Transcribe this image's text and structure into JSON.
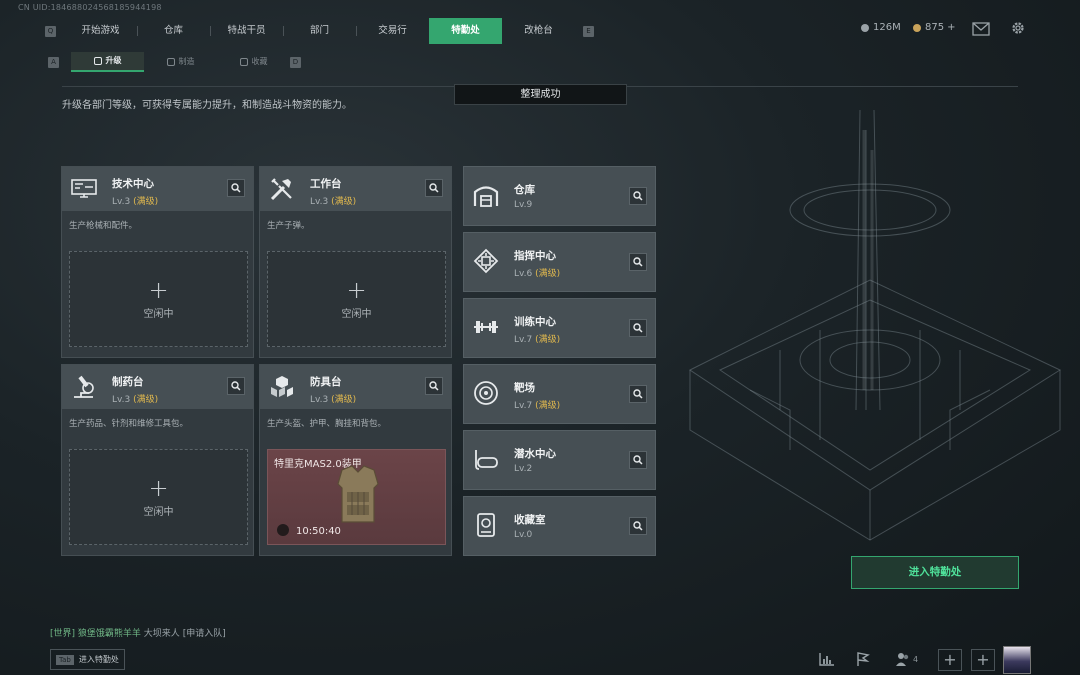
{
  "uid": "CN UID:184688024568185944198",
  "nav": {
    "left_key": "Q",
    "right_key": "E",
    "tabs": [
      "开始游戏",
      "仓库",
      "特战干员",
      "部门",
      "交易行",
      "特勤处",
      "改枪台"
    ],
    "active_tab": "特勤处"
  },
  "currency": {
    "coins": "126M",
    "points": "875",
    "points_plus": "+"
  },
  "subnav": {
    "left_key": "A",
    "right_key": "D",
    "tabs": [
      "升级",
      "制造",
      "收藏"
    ],
    "active": "升级"
  },
  "description": "升级各部门等级，可获得专属能力提升，和制造战斗物资的能力。",
  "toast": "整理成功",
  "idle_label": "空闲中",
  "max_label": "(满级)",
  "craft_departments": [
    {
      "name": "技术中心",
      "level": "Lv.3",
      "desc": "生产枪械和配件。",
      "icon": "tech-center-icon"
    },
    {
      "name": "工作台",
      "level": "Lv.3",
      "desc": "生产子弹。",
      "icon": "workbench-icon"
    },
    {
      "name": "制药台",
      "level": "Lv.3",
      "desc": "生产药品、针剂和维修工具包。",
      "icon": "pharmacy-icon"
    },
    {
      "name": "防具台",
      "level": "Lv.3",
      "desc": "生产头盔、护甲、胸挂和背包。",
      "icon": "armor-bench-icon"
    }
  ],
  "crafting_item": {
    "name": "特里克MAS2.0装甲",
    "time": "10:50:40"
  },
  "other_departments": [
    {
      "name": "仓库",
      "level": "Lv.9",
      "max": false,
      "icon": "warehouse-icon"
    },
    {
      "name": "指挥中心",
      "level": "Lv.6",
      "max": true,
      "icon": "command-center-icon"
    },
    {
      "name": "训练中心",
      "level": "Lv.7",
      "max": true,
      "icon": "training-center-icon"
    },
    {
      "name": "靶场",
      "level": "Lv.7",
      "max": true,
      "icon": "shooting-range-icon"
    },
    {
      "name": "潜水中心",
      "level": "Lv.2",
      "max": false,
      "icon": "diving-center-icon"
    },
    {
      "name": "收藏室",
      "level": "Lv.0",
      "max": false,
      "icon": "collection-room-icon"
    }
  ],
  "enter_button": "进入特勤处",
  "chat": {
    "channel": "[世界]",
    "sender": "狼堡饿霸熊羊羊",
    "message": "大坝来人",
    "action": "[申请入队]"
  },
  "tab_hint": {
    "key": "Tab",
    "label": "进入特勤处"
  },
  "friends_count": "4",
  "colors": {
    "accent": "#34a66f",
    "max_level": "#e0b84e",
    "crafting_bg": "#6b4448"
  }
}
